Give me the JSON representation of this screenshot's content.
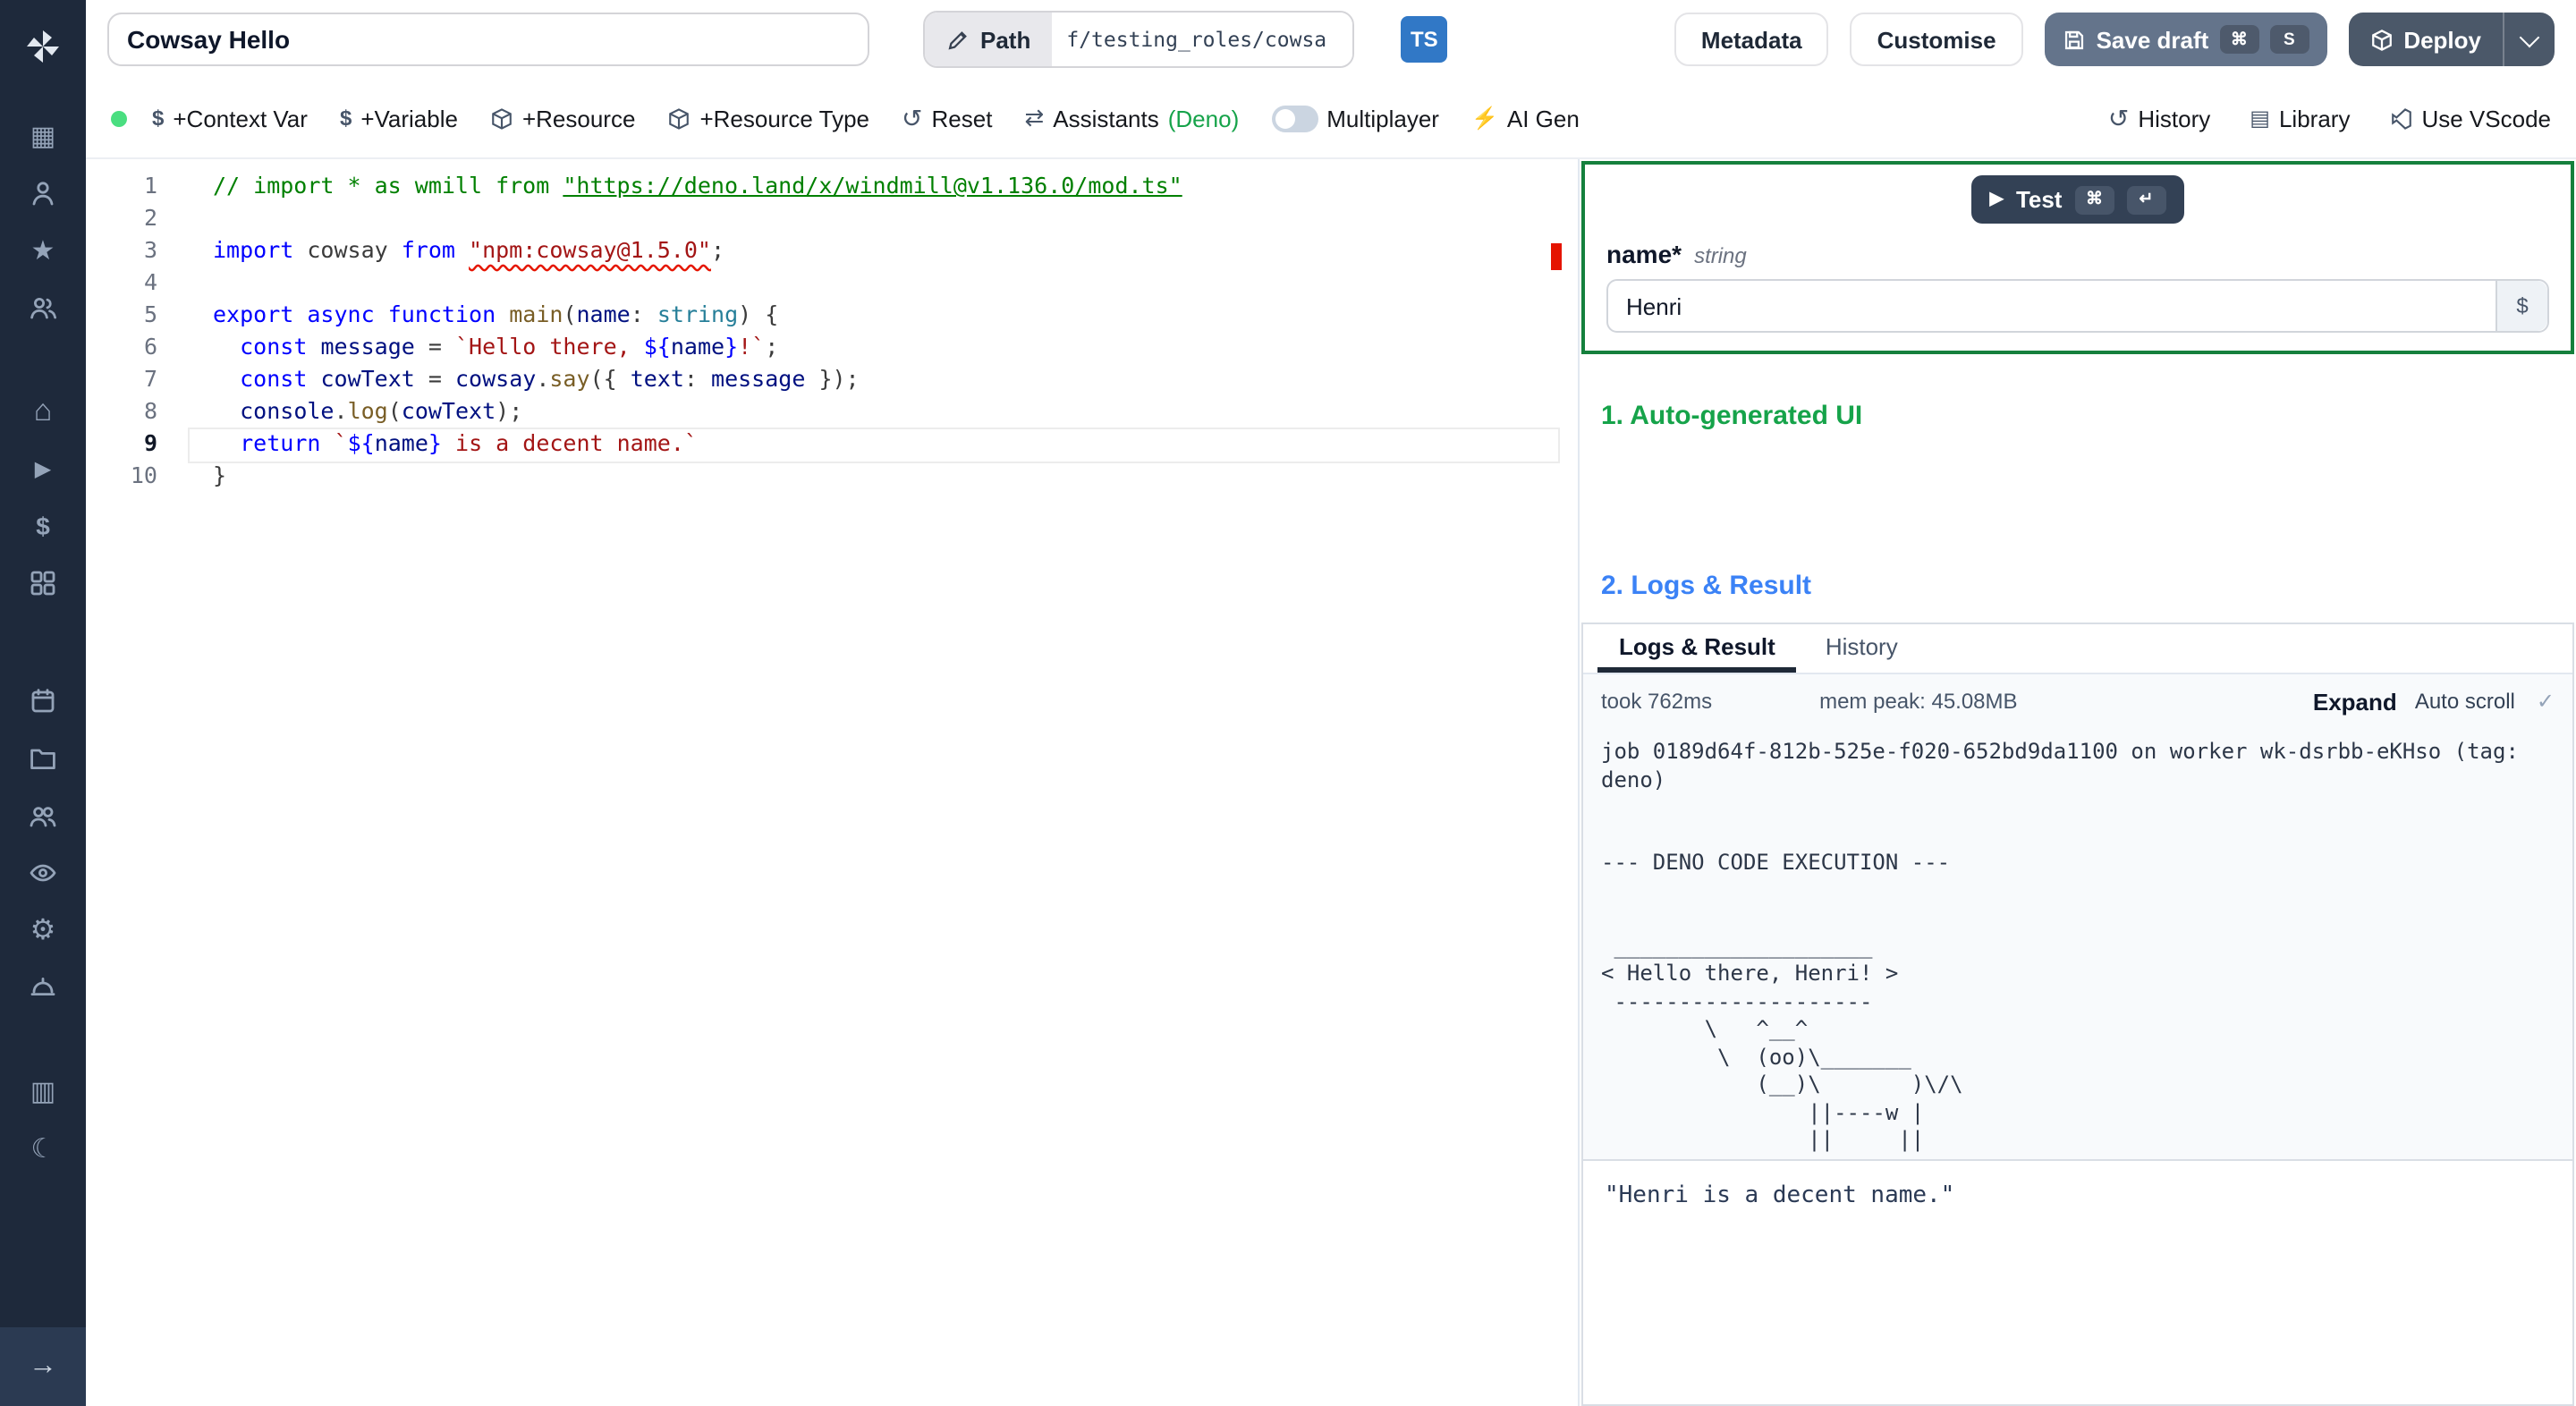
{
  "colors": {
    "sidebar_bg": "#1e293b",
    "accent_green": "#16a34a",
    "accent_blue": "#3b82f6",
    "test_border_green": "#15803d",
    "save_btn": "#64748b",
    "deploy_btn": "#4b5869",
    "ts_badge": "#3178c6",
    "error_red": "#e51400"
  },
  "topbar": {
    "script_name": "Cowsay Hello",
    "path_label": "Path",
    "path_value": "f/testing_roles/cowsa",
    "lang_badge": "TS",
    "metadata": "Metadata",
    "customise": "Customise",
    "save_draft": "Save draft",
    "save_kbd1": "⌘",
    "save_kbd2": "S",
    "deploy": "Deploy"
  },
  "toolbar": {
    "context_var": "+Context Var",
    "variable": "+Variable",
    "resource": "+Resource",
    "resource_type": "+Resource Type",
    "reset": "Reset",
    "assistants": "Assistants",
    "assistants_lang": "(Deno)",
    "multiplayer": "Multiplayer",
    "ai_gen": "AI Gen",
    "history": "History",
    "library": "Library",
    "use_vscode": "Use VScode"
  },
  "editor": {
    "active_line": 9,
    "lines": [
      [
        [
          "c",
          "// import * as wmill from "
        ],
        [
          "cu",
          "\"https://deno.land/x/windmill@v1.136.0/mod.ts\""
        ]
      ],
      [],
      [
        [
          "k",
          "import"
        ],
        [
          "p",
          " cowsay "
        ],
        [
          "k",
          "from"
        ],
        [
          "p",
          " "
        ],
        [
          "sq",
          "\"npm:cowsay@1.5.0\""
        ],
        [
          "p",
          ";"
        ]
      ],
      [],
      [
        [
          "k",
          "export"
        ],
        [
          "p",
          " "
        ],
        [
          "k",
          "async"
        ],
        [
          "p",
          " "
        ],
        [
          "k",
          "function"
        ],
        [
          "p",
          " "
        ],
        [
          "f",
          "main"
        ],
        [
          "p",
          "("
        ],
        [
          "i",
          "name"
        ],
        [
          "p",
          ": "
        ],
        [
          "t",
          "string"
        ],
        [
          "p",
          ") {"
        ]
      ],
      [
        [
          "p",
          "  "
        ],
        [
          "k",
          "const"
        ],
        [
          "p",
          " "
        ],
        [
          "i",
          "message"
        ],
        [
          "p",
          " = "
        ],
        [
          "s",
          "`Hello there, "
        ],
        [
          "ib",
          "${"
        ],
        [
          "i",
          "name"
        ],
        [
          "ib",
          "}"
        ],
        [
          "s",
          "!`"
        ],
        [
          "p",
          ";"
        ]
      ],
      [
        [
          "p",
          "  "
        ],
        [
          "k",
          "const"
        ],
        [
          "p",
          " "
        ],
        [
          "i",
          "cowText"
        ],
        [
          "p",
          " = "
        ],
        [
          "i",
          "cowsay"
        ],
        [
          "p",
          "."
        ],
        [
          "f",
          "say"
        ],
        [
          "p",
          "({ "
        ],
        [
          "i",
          "text"
        ],
        [
          "p",
          ": "
        ],
        [
          "i",
          "message"
        ],
        [
          "p",
          " });"
        ]
      ],
      [
        [
          "p",
          "  "
        ],
        [
          "i",
          "console"
        ],
        [
          "p",
          "."
        ],
        [
          "f",
          "log"
        ],
        [
          "p",
          "("
        ],
        [
          "i",
          "cowText"
        ],
        [
          "p",
          ");"
        ]
      ],
      [
        [
          "p",
          "  "
        ],
        [
          "k",
          "return"
        ],
        [
          "p",
          " "
        ],
        [
          "s",
          "`"
        ],
        [
          "ib",
          "${"
        ],
        [
          "i",
          "name"
        ],
        [
          "ib",
          "}"
        ],
        [
          "s",
          " is a decent name.`"
        ]
      ],
      [
        [
          "p",
          "}"
        ]
      ]
    ]
  },
  "test_panel": {
    "test_label": "Test",
    "test_kbd1": "⌘",
    "test_kbd2": "↵",
    "field_name": "name",
    "field_required": "*",
    "field_type": "string",
    "field_value": "Henri",
    "json_toggle": "$"
  },
  "sections": {
    "auto_ui": "1. Auto-generated UI",
    "logs_result": "2. Logs & Result"
  },
  "logs": {
    "tab_logs": "Logs & Result",
    "tab_history": "History",
    "took": "took 762ms",
    "mem": "mem peak: 45.08MB",
    "expand": "Expand",
    "autoscroll": "Auto scroll",
    "text": "job 0189d64f-812b-525e-f020-652bd9da1100 on worker wk-dsrbb-eKHso (tag:\ndeno)\n\n\n--- DENO CODE EXECUTION ---\n\n\n ____________________\n< Hello there, Henri! >\n --------------------\n        \\   ^__^\n         \\  (oo)\\_______\n            (__)\\       )\\/\\\n                ||----w |\n                ||     ||"
  },
  "result": {
    "text": "\"Henri is a decent name.\""
  },
  "icons": {
    "grid": "▦",
    "star": "★",
    "home": "⌂",
    "play": "▶",
    "dollar": "$",
    "gear": "⚙",
    "docs": "▥",
    "moon": "☾",
    "collapse": "→",
    "reset": "↺",
    "assistants": "⇄",
    "ai": "⚡",
    "history": "↺",
    "library": "▤",
    "check": "✓",
    "play_small": "▶"
  }
}
